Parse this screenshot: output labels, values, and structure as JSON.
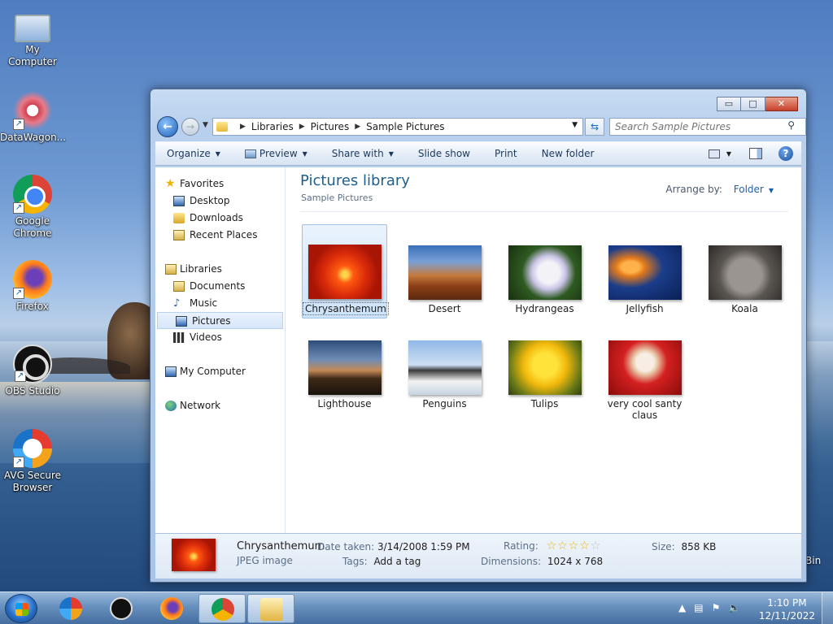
{
  "desktop": {
    "icons": [
      {
        "label": "My Computer"
      },
      {
        "label": "DataWagon..."
      },
      {
        "label": "Google Chrome"
      },
      {
        "label": "Firefox"
      },
      {
        "label": "OBS Studio"
      },
      {
        "label": "AVG Secure Browser"
      }
    ],
    "partial_label": "Bin"
  },
  "window": {
    "controls": {
      "minimize": "▭",
      "maximize": "□",
      "close": "✕"
    },
    "address": {
      "crumbs": [
        "Libraries",
        "Pictures",
        "Sample Pictures"
      ]
    },
    "search": {
      "placeholder": "Search Sample Pictures"
    },
    "toolbar": {
      "organize": "Organize",
      "preview": "Preview",
      "share_with": "Share with",
      "slide_show": "Slide show",
      "print": "Print",
      "new_folder": "New folder"
    },
    "nav": {
      "favorites": "Favorites",
      "desktop": "Desktop",
      "downloads": "Downloads",
      "recent_places": "Recent Places",
      "libraries": "Libraries",
      "documents": "Documents",
      "music": "Music",
      "pictures": "Pictures",
      "videos": "Videos",
      "my_computer": "My Computer",
      "network": "Network"
    },
    "main": {
      "title": "Pictures library",
      "subtitle": "Sample Pictures",
      "arrange_label": "Arrange by:",
      "arrange_value": "Folder",
      "files": [
        {
          "name": "Chrysanthemum",
          "selected": true
        },
        {
          "name": "Desert"
        },
        {
          "name": "Hydrangeas"
        },
        {
          "name": "Jellyfish"
        },
        {
          "name": "Koala"
        },
        {
          "name": "Lighthouse"
        },
        {
          "name": "Penguins"
        },
        {
          "name": "Tulips"
        },
        {
          "name": "very cool santy claus"
        }
      ]
    },
    "details": {
      "name": "Chrysanthemum",
      "type": "JPEG image",
      "date_label": "Date taken:",
      "date_value": "3/14/2008 1:59 PM",
      "tags_label": "Tags:",
      "tags_value": "Add a tag",
      "rating_label": "Rating:",
      "rating_value": 0,
      "rating_max": 5,
      "dimensions_label": "Dimensions:",
      "dimensions_value": "1024 x 768",
      "size_label": "Size:",
      "size_value": "858 KB"
    }
  },
  "taskbar": {
    "clock_time": "1:10 PM",
    "clock_date": "12/11/2022"
  }
}
